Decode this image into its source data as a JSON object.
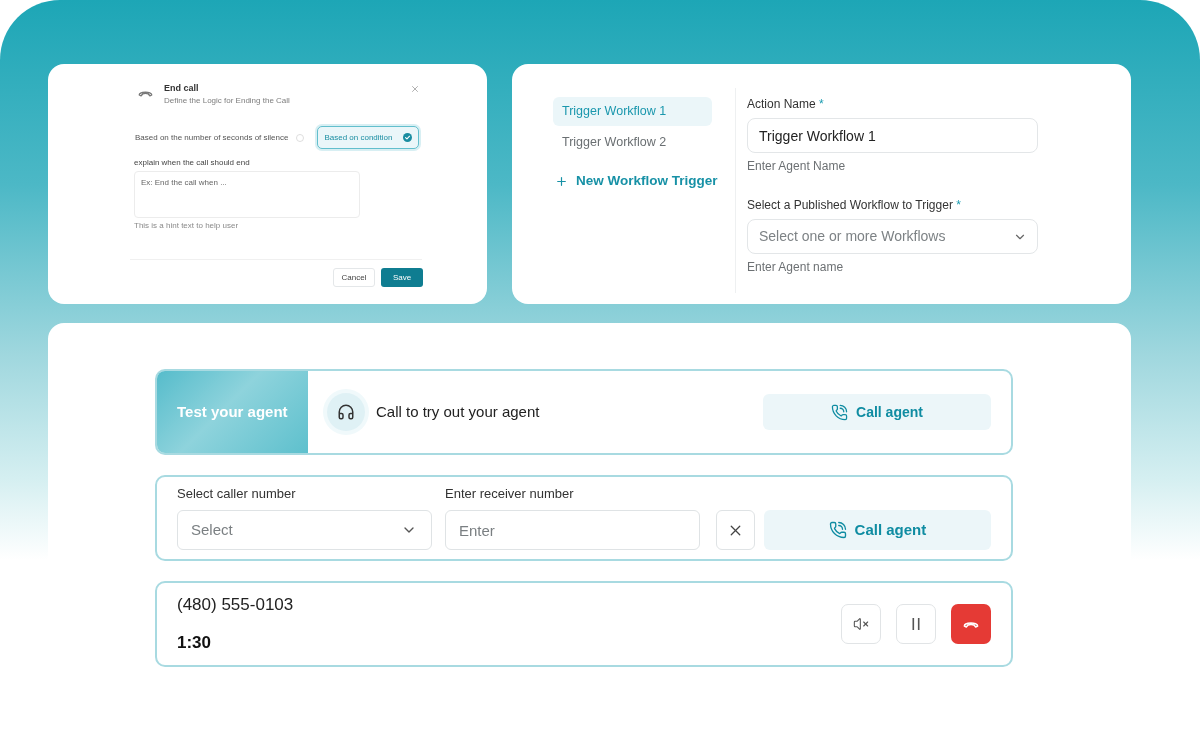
{
  "end_call_dialog": {
    "title": "End call",
    "subtitle": "Define the Logic for Ending the Call",
    "options": [
      {
        "label": "Based on the number of seconds of silence",
        "selected": false
      },
      {
        "label": "Based on condition",
        "selected": true
      }
    ],
    "condition_field": {
      "label": "explain when the call should end",
      "placeholder": "Ex: End the call when ...",
      "hint": "This is a hint text to help user"
    },
    "buttons": [
      {
        "label": "Cancel",
        "kind": "secondary"
      },
      {
        "label": "Save",
        "kind": "primary"
      }
    ]
  },
  "workflow_trigger": {
    "triggers": [
      {
        "label": "Trigger Workflow 1",
        "selected": true
      },
      {
        "label": "Trigger Workflow 2",
        "selected": false
      }
    ],
    "new_trigger": "New Workflow Trigger",
    "fields": [
      {
        "kind": "input",
        "label": "Action Name",
        "required_mark": "*",
        "value": "Trigger Workflow 1",
        "hint": "Enter Agent Name"
      },
      {
        "kind": "select",
        "label": "Select a Published Workflow to Trigger",
        "required_mark": "*",
        "placeholder": "Select one or more Workflows",
        "hint": "Enter Agent name"
      }
    ]
  },
  "test_agent": {
    "banner": "Test your agent",
    "prompt": "Call to try out your agent",
    "call_button": "Call agent"
  },
  "dialer": {
    "fields": [
      {
        "kind": "select",
        "label": "Select caller number",
        "placeholder": "Select"
      },
      {
        "kind": "input",
        "label": "Enter receiver number",
        "placeholder": "Enter"
      }
    ],
    "call_button": "Call agent"
  },
  "active_call": {
    "number": "(480) 555-0103",
    "duration": "1:30"
  }
}
